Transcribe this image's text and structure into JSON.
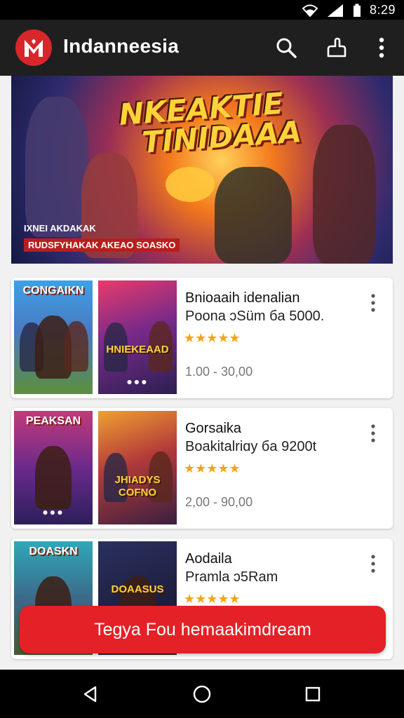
{
  "status_bar": {
    "time": "8:29"
  },
  "app_bar": {
    "title": "Indanneesia",
    "icons": [
      "app-logo-icon",
      "search-icon",
      "share-icon",
      "more-vertical-icon"
    ],
    "colors": {
      "background": "#1f1f1f",
      "logo": "#d8262b"
    }
  },
  "banner": {
    "title_line1": "NKEAKTIE",
    "title_line2": "TINIDAAA",
    "subtitle": "IXNEI AKDAKAK",
    "tagline": "RUDSFYHAKAK AKEAO SOASKO"
  },
  "cards": [
    {
      "thumb1_caption": "CONGAIKN",
      "thumb2_caption": "HNIEKEAAD",
      "title": "Bnioaaih idenalian",
      "subtitle": "Poona ɔSüm бa 5000.",
      "stars": "★★★★★",
      "price": "1.00 - 30,00"
    },
    {
      "thumb1_caption": "PEAKSAN",
      "thumb2_caption": "JHIADYS COFNO",
      "title": "Gorsaika",
      "subtitle": "Boakitalriɑy бa 9200t",
      "stars": "★★★★★",
      "price": "2,00 - 90,00"
    },
    {
      "thumb1_caption": "DOASKN",
      "thumb2_caption": "DOAASUS",
      "title": "Aodaila",
      "subtitle": "Pramla ɔ5Ram",
      "stars": "★★★★★",
      "price": ""
    }
  ],
  "cta": {
    "label": "Tegya Fou hemaakimdream",
    "color": "#e32127"
  },
  "nav": {
    "icons": [
      "back-icon",
      "home-icon",
      "recents-icon"
    ]
  }
}
